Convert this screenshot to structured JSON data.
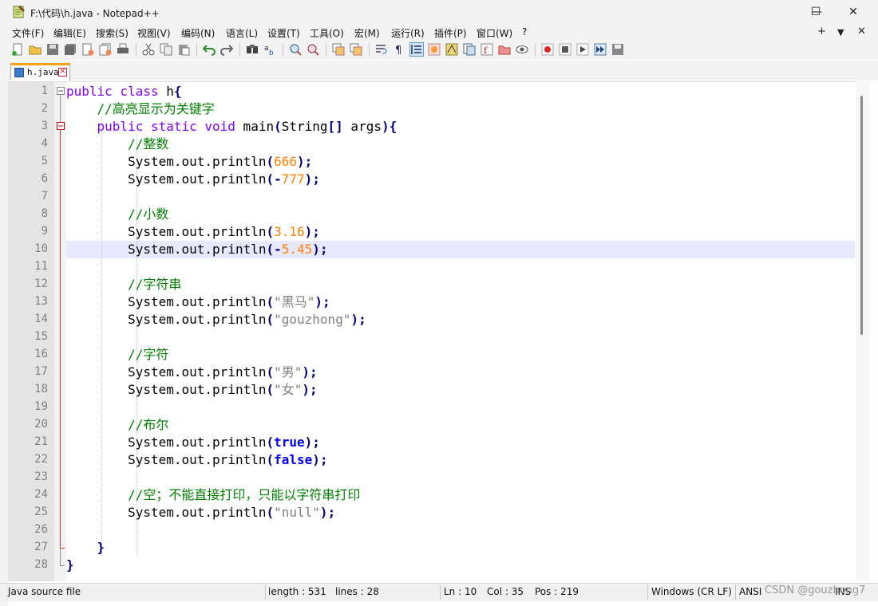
{
  "window": {
    "title": "F:\\代码\\h.java - Notepad++",
    "minimize": "—",
    "maximize": "☐",
    "close": "✕"
  },
  "menu": {
    "items": [
      {
        "label": "文件(F)"
      },
      {
        "label": "编辑(E)"
      },
      {
        "label": "搜索(S)"
      },
      {
        "label": "视图(V)"
      },
      {
        "label": "编码(N)"
      },
      {
        "label": "语言(L)"
      },
      {
        "label": "设置(T)"
      },
      {
        "label": "工具(O)"
      },
      {
        "label": "宏(M)"
      },
      {
        "label": "运行(R)"
      },
      {
        "label": "插件(P)"
      },
      {
        "label": "窗口(W)"
      },
      {
        "label": "?"
      }
    ],
    "plus": "+",
    "dropdown": "▼",
    "close": "✕"
  },
  "tab": {
    "label": "h.java",
    "close": "✕"
  },
  "editor": {
    "current_line": 10,
    "lines": [
      {
        "n": "1"
      },
      {
        "n": "2"
      },
      {
        "n": "3"
      },
      {
        "n": "4"
      },
      {
        "n": "5"
      },
      {
        "n": "6"
      },
      {
        "n": "7"
      },
      {
        "n": "8"
      },
      {
        "n": "9"
      },
      {
        "n": "10"
      },
      {
        "n": "11"
      },
      {
        "n": "12"
      },
      {
        "n": "13"
      },
      {
        "n": "14"
      },
      {
        "n": "15"
      },
      {
        "n": "16"
      },
      {
        "n": "17"
      },
      {
        "n": "18"
      },
      {
        "n": "19"
      },
      {
        "n": "20"
      },
      {
        "n": "21"
      },
      {
        "n": "22"
      },
      {
        "n": "23"
      },
      {
        "n": "24"
      },
      {
        "n": "25"
      },
      {
        "n": "26"
      },
      {
        "n": "27"
      },
      {
        "n": "28"
      }
    ],
    "code": {
      "l1_kw": "public class",
      "l1_name": " h",
      "l1_brace": "{",
      "l2_comment": "//高亮显示为关键字",
      "l3_kw": "public static void",
      "l3_rest": " main",
      "l3_p1": "(",
      "l3_type": "String",
      "l3_br": "[]",
      "l3_args": " args",
      "l3_p2": ")",
      "l3_brace": "{",
      "l4_comment": "//整数",
      "l5_value": "666",
      "l6_minus": "-",
      "l6_value": "777",
      "l8_comment": "//小数",
      "l9_value": "3.16",
      "l10_minus": "-",
      "l10_value": "5.45",
      "l12_comment": "//字符串",
      "l13_value": "\"黑马\"",
      "l14_value": "\"gouzhong\"",
      "l16_comment": "//字符",
      "l17_value": "\"男\"",
      "l18_value": "\"女\"",
      "l20_comment": "//布尔",
      "l21_value": "true",
      "l22_value": "false",
      "l24_comment": "//空；不能直接打印，只能以字符串打印",
      "l25_value": "\"null\"",
      "l27_brace": "}",
      "l28_brace": "}",
      "call_prefix": "System",
      "call_dot1": ".",
      "call_out": "out",
      "call_dot2": ".",
      "call_method": "println",
      "lp": "(",
      "rp": ")",
      "semi": ";"
    }
  },
  "status": {
    "file_type": "Java source file",
    "length": "length : 531",
    "lines": "lines : 28",
    "ln": "Ln : 10",
    "col": "Col : 35",
    "pos": "Pos : 219",
    "eol": "Windows (CR LF)",
    "encoding": "ANSI",
    "ins": "INS",
    "watermark": "CSDN @gouzhong7"
  }
}
